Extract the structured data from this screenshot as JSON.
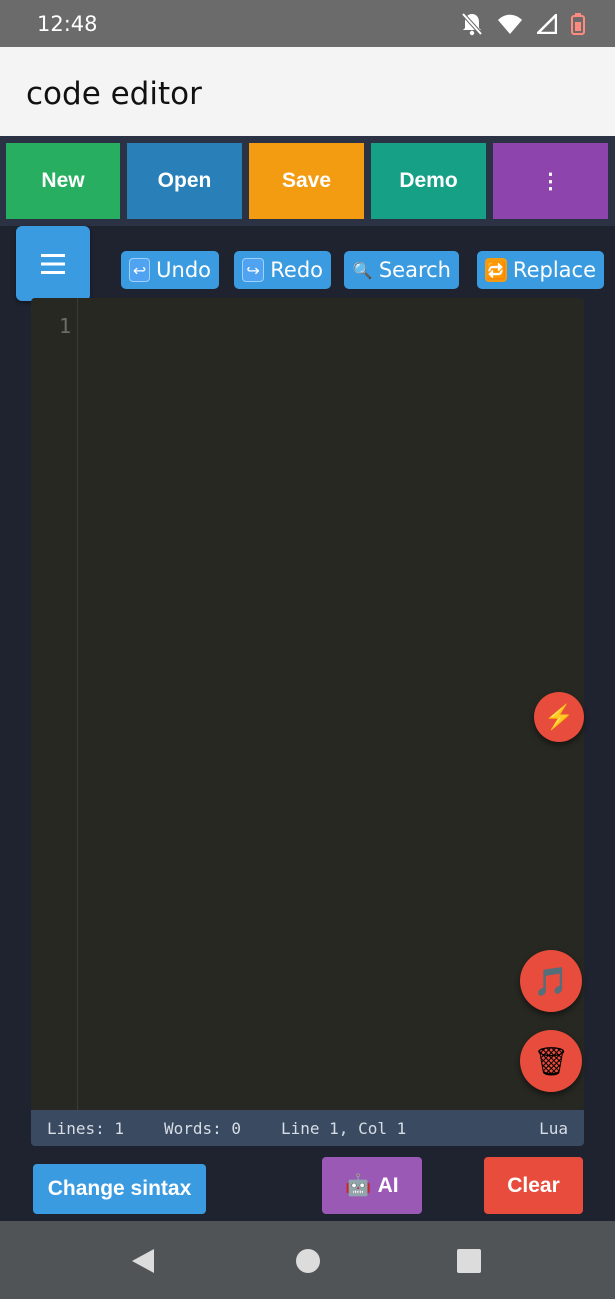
{
  "status": {
    "time": "12:48"
  },
  "app": {
    "title": "code editor"
  },
  "toolbar": {
    "new": "New",
    "open": "Open",
    "save": "Save",
    "demo": "Demo",
    "more": "⋮",
    "colors": {
      "new": "#27ae60",
      "open": "#2980b9",
      "save": "#f39c12",
      "demo": "#16a085",
      "more": "#8e44ad"
    }
  },
  "actions": {
    "undo": {
      "emoji": "↩",
      "label": "Undo"
    },
    "redo": {
      "emoji": "↪",
      "label": "Redo"
    },
    "search": {
      "emoji": "🔍",
      "label": "Search"
    },
    "replace": {
      "emoji": "🔁",
      "label": "Replace"
    }
  },
  "editor": {
    "line_number": "1"
  },
  "statusline": {
    "lines": "Lines: 1",
    "words": "Words: 0",
    "position": "Line 1, Col 1",
    "language": "Lua"
  },
  "fabs": {
    "run_icon": "⚡",
    "music_icon": "🎵",
    "trash_icon": "🗑"
  },
  "bottom": {
    "change_syntax": "Change sintax",
    "ai_emoji": "🤖",
    "ai": "AI",
    "clear": "Clear"
  }
}
